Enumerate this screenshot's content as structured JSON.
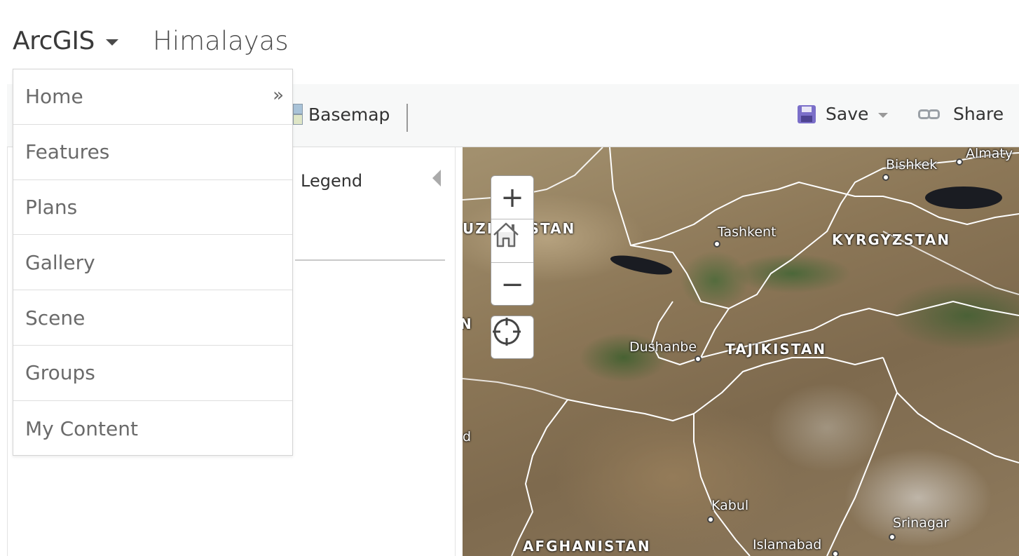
{
  "header": {
    "app_name": "ArcGIS",
    "map_title": "Himalayas"
  },
  "toolbar": {
    "basemap_label": "Basemap",
    "save_label": "Save",
    "share_label": "Share"
  },
  "side_panel": {
    "legend_label": "Legend"
  },
  "app_menu": {
    "items": [
      {
        "label": "Home",
        "chevron": "»"
      },
      {
        "label": "Features"
      },
      {
        "label": "Plans"
      },
      {
        "label": "Gallery"
      },
      {
        "label": "Scene"
      },
      {
        "label": "Groups"
      },
      {
        "label": "My Content"
      }
    ]
  },
  "map": {
    "zoom_in": "+",
    "zoom_out": "−",
    "countries": [
      "UZBEKISTAN",
      "KYRGYZSTAN",
      "TAJIKISTAN",
      "AFGHANISTAN"
    ],
    "cities": [
      "Bishkek",
      "Almaty",
      "Tashkent",
      "Dushanbe",
      "Kabul",
      "Srinagar",
      "Islamabad"
    ],
    "edge_fragments": [
      "N",
      "d"
    ]
  },
  "colors": {
    "save_icon": "#7b6fc9",
    "toolbar_bg": "#f7f8f8",
    "menu_text": "#6a6a6a"
  }
}
